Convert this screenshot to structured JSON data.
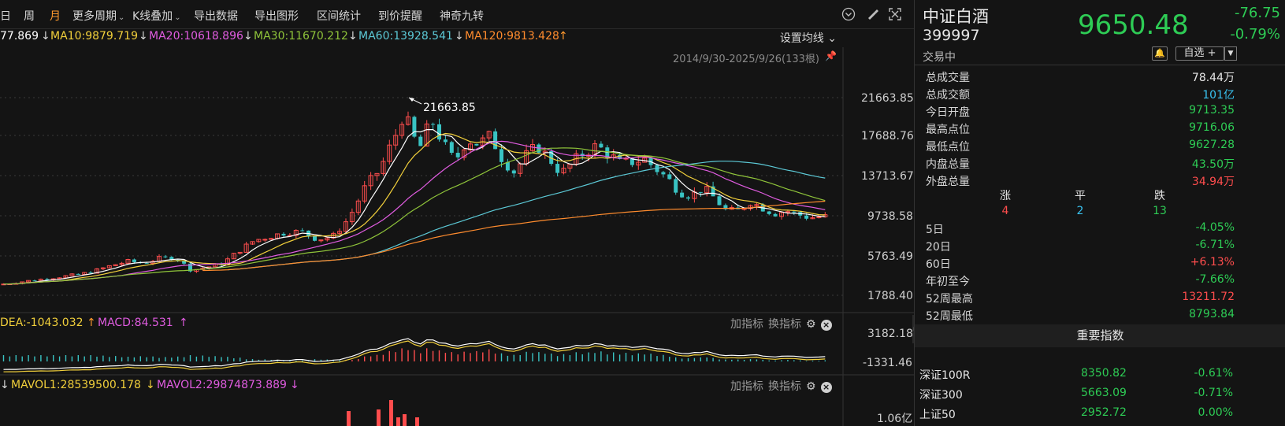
{
  "toolbar": {
    "items": [
      "日",
      "周",
      "月",
      "更多周期",
      "K线叠加",
      "导出数据",
      "导出图形",
      "区间统计",
      "到价提醒",
      "神奇九转"
    ],
    "active_index": 2
  },
  "ma_row": {
    "ma5_fragment": "77.869",
    "ma10": "MA10:9879.719",
    "ma20": "MA20:10618.896",
    "ma30": "MA30:11670.212",
    "ma60": "MA60:13928.541",
    "ma120": "MA120:9813.428",
    "colors": {
      "ma5": "#ffffff",
      "ma10": "#f2d03b",
      "ma20": "#e05ce0",
      "ma30": "#8fc43a",
      "ma60": "#5cc9d6",
      "ma120": "#ff8c2e"
    },
    "settings_label": "设置均线"
  },
  "chart": {
    "range_label": "2014/9/30-2025/9/26(133根)",
    "max_label": "21663.85",
    "y_ticks": [
      "21663.85",
      "17688.76",
      "13713.67",
      "9738.58",
      "5763.49",
      "1788.40"
    ],
    "up_color": "#ff4d4d",
    "down_color": "#39c3c3"
  },
  "macd": {
    "dea": "DEA:-1043.032",
    "macd": "MACD:84.531",
    "y_ticks": [
      "3182.18",
      "-1331.46"
    ],
    "add_indicator": "加指标",
    "switch_indicator": "换指标"
  },
  "volume": {
    "mavol1": "MAVOL1:28539500.178",
    "mavol2": "MAVOL2:29874873.889",
    "y_tick": "1.06亿",
    "add_indicator": "加指标",
    "switch_indicator": "换指标"
  },
  "quote": {
    "name": "中证白酒",
    "code": "399997",
    "status": "交易中",
    "price": "9650.48",
    "change": "-76.75",
    "change_pct": "-0.79%",
    "watchlist_label": "自选 +",
    "stats": [
      {
        "label": "总成交量",
        "value": "78.44万",
        "color": "white"
      },
      {
        "label": "总成交额",
        "value": "101亿",
        "color": "blue"
      },
      {
        "label": "今日开盘",
        "value": "9713.35",
        "color": "green"
      },
      {
        "label": "最高点位",
        "value": "9716.06",
        "color": "green"
      },
      {
        "label": "最低点位",
        "value": "9627.28",
        "color": "green"
      },
      {
        "label": "内盘总量",
        "value": "43.50万",
        "color": "green"
      },
      {
        "label": "外盘总量",
        "value": "34.94万",
        "color": "red"
      }
    ],
    "breadth": {
      "up_label": "涨",
      "flat_label": "平",
      "down_label": "跌",
      "up": "4",
      "flat": "2",
      "down": "13"
    },
    "periods": [
      {
        "label": "5日",
        "value": "-4.05%",
        "color": "green"
      },
      {
        "label": "20日",
        "value": "-6.71%",
        "color": "green"
      },
      {
        "label": "60日",
        "value": "+6.13%",
        "color": "red"
      },
      {
        "label": "年初至今",
        "value": "-7.66%",
        "color": "green"
      },
      {
        "label": "52周最高",
        "value": "13211.72",
        "color": "red"
      },
      {
        "label": "52周最低",
        "value": "8793.84",
        "color": "green"
      }
    ]
  },
  "indices": {
    "header": "重要指数",
    "rows": [
      {
        "name": "深证100R",
        "price": "8350.82",
        "change": "-0.61%"
      },
      {
        "name": "深证300",
        "price": "5663.09",
        "change": "-0.71%"
      },
      {
        "name": "上证50",
        "price": "2952.72",
        "change": "0.00%"
      }
    ]
  }
}
